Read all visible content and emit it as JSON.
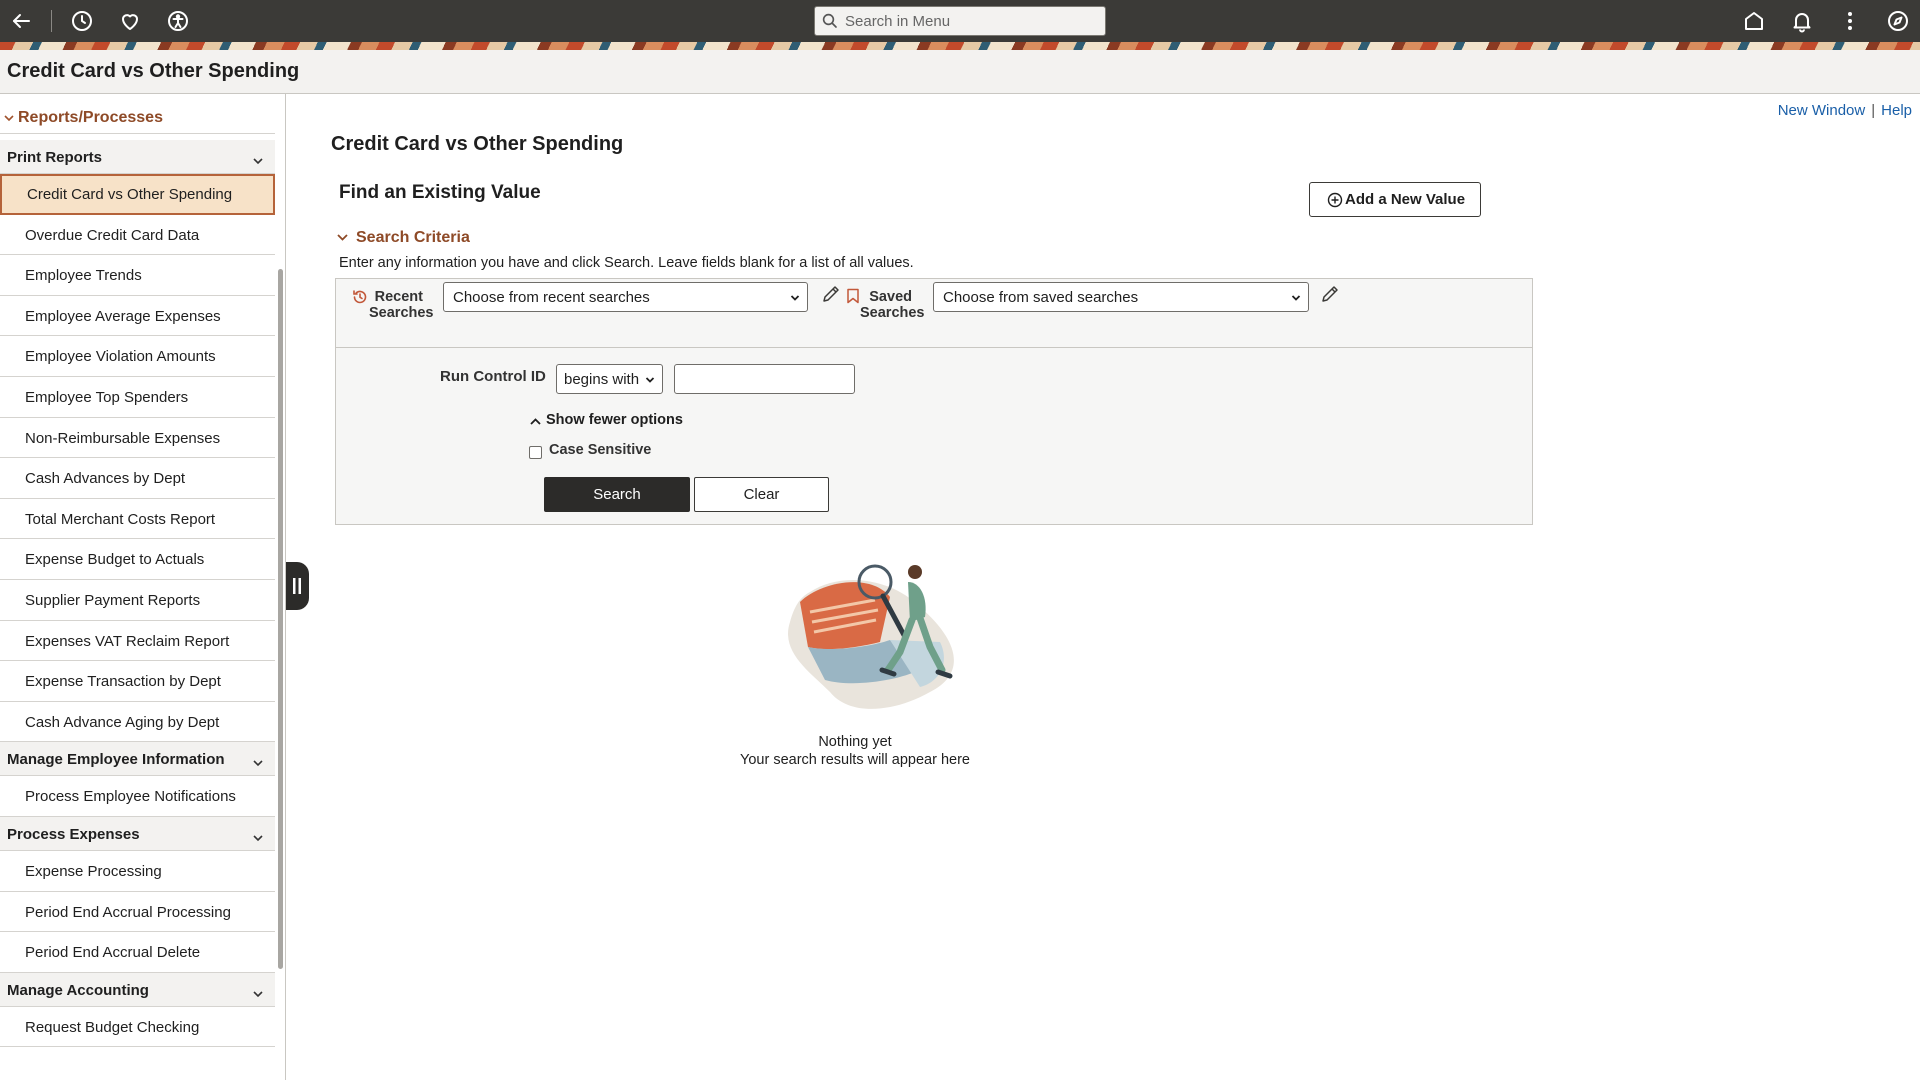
{
  "topbar": {
    "icons": [
      "back-arrow-icon",
      "history-icon",
      "heart-icon",
      "accessibility-icon",
      "home-icon",
      "bell-icon",
      "more-vertical-icon",
      "compass-icon"
    ],
    "search_placeholder": "Search in Menu"
  },
  "page": {
    "title": "Credit Card vs Other Spending"
  },
  "nav": {
    "group": "Reports/Processes",
    "sections": [
      {
        "label": "Print Reports",
        "items": [
          "Credit Card vs Other Spending",
          "Overdue Credit Card Data",
          "Employee Trends",
          "Employee Average Expenses",
          "Employee Violation Amounts",
          "Employee Top Spenders",
          "Non-Reimbursable Expenses",
          "Cash Advances by Dept",
          "Total Merchant Costs Report",
          "Expense Budget to Actuals",
          "Supplier Payment Reports",
          "Expenses VAT Reclaim Report",
          "Expense Transaction by Dept",
          "Cash Advance Aging by Dept"
        ]
      },
      {
        "label": "Manage Employee Information",
        "items": [
          "Process Employee Notifications"
        ]
      },
      {
        "label": "Process Expenses",
        "items": [
          "Expense Processing",
          "Period End Accrual Processing",
          "Period End Accrual Delete"
        ]
      },
      {
        "label": "Manage Accounting",
        "items": [
          "Request Budget Checking"
        ]
      }
    ],
    "selected": "Credit Card vs Other Spending"
  },
  "links": {
    "new_window": "New Window",
    "separator": "|",
    "help": "Help"
  },
  "main": {
    "title": "Credit Card vs Other Spending",
    "find_title": "Find an Existing Value",
    "add_button": "Add a New Value",
    "criteria_label": "Search Criteria",
    "instructions": "Enter any information you have and click Search. Leave fields blank for a list of all values.",
    "recent_label_1": "Recent",
    "recent_label_2": "Searches",
    "recent_select": "Choose from recent searches",
    "saved_label_1": "Saved",
    "saved_label_2": "Searches",
    "saved_select": "Choose from saved searches",
    "run_control_label": "Run Control ID",
    "operator": "begins with",
    "run_control_value": "",
    "fewer_options": "Show fewer options",
    "case_sensitive": "Case Sensitive",
    "case_checked": false,
    "search_button": "Search",
    "clear_button": "Clear",
    "empty_title": "Nothing yet",
    "empty_subtitle": "Your search results will appear here"
  },
  "colors": {
    "topbar": "#3b3a37",
    "accent": "#8e4a27",
    "selected_bg": "#f7e2c8",
    "link": "#1a5fa8",
    "primary_button": "#2c2b29"
  }
}
